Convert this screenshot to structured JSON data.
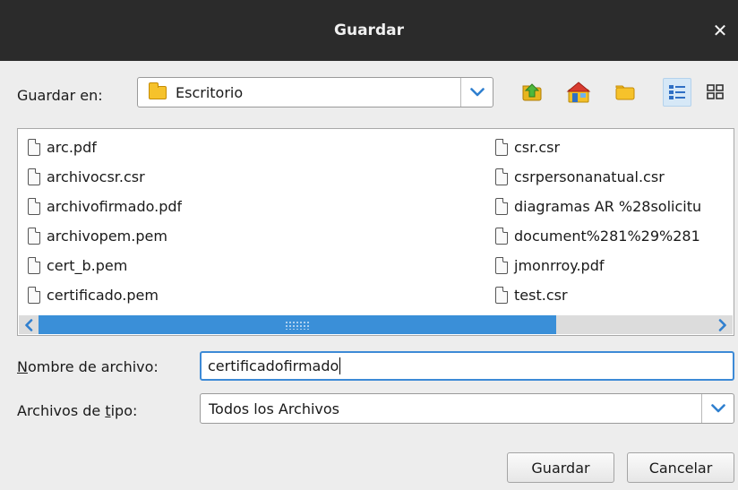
{
  "dialog": {
    "title": "Guardar",
    "close_glyph": "✕"
  },
  "save_in": {
    "label_before": "Guardar en",
    "label_after": ":",
    "selected": "Escritorio",
    "folder_icon": "folder-icon"
  },
  "toolbar": {
    "icons": [
      "up-folder-icon",
      "home-icon",
      "new-folder-icon",
      "list-view-icon",
      "details-view-icon"
    ],
    "active": "list-view-icon"
  },
  "files": {
    "left": [
      "arc.pdf",
      "archivocsr.csr",
      "archivofirmado.pdf",
      "archivopem.pem",
      "cert_b.pem",
      "certificado.pem"
    ],
    "right": [
      "csr.csr",
      "csrpersonanatual.csr",
      "diagramas AR %28solicitu",
      "document%281%29%281",
      "jmonrroy.pdf",
      "test.csr"
    ]
  },
  "filename": {
    "label_underlined": "N",
    "label_rest": "ombre de archivo:",
    "value": "certificadofirmado"
  },
  "filetype": {
    "label_before": "Archivos de ",
    "label_underlined": "t",
    "label_after": "ipo:",
    "selected": "Todos los Archivos"
  },
  "buttons": {
    "save": "Guardar",
    "cancel": "Cancelar"
  },
  "colors": {
    "titlebar": "#2b2b2b",
    "accent": "#3a8fd8",
    "folder": "#f6c22b"
  }
}
